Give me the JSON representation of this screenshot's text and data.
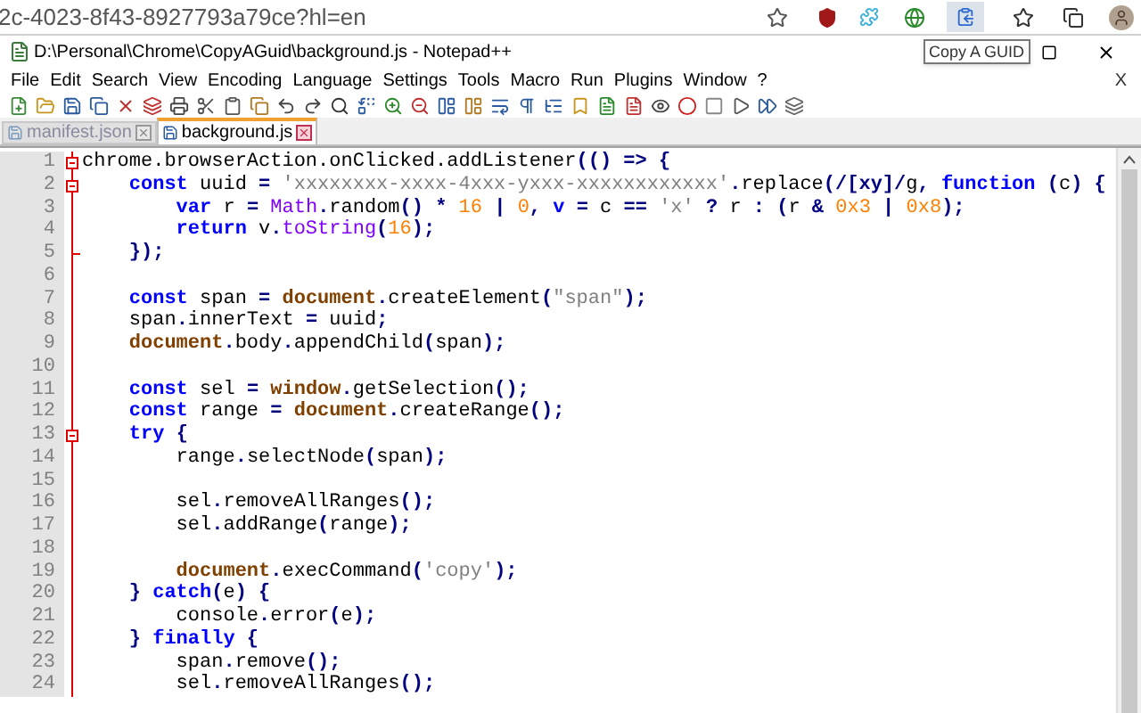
{
  "browser": {
    "url": "2c-4023-8f43-8927793a79ce?hl=en",
    "tooltip": "Copy A GUID"
  },
  "window": {
    "title": "D:\\Personal\\Chrome\\CopyAGuid\\background.js - Notepad++"
  },
  "menu": [
    "File",
    "Edit",
    "Search",
    "View",
    "Encoding",
    "Language",
    "Settings",
    "Tools",
    "Macro",
    "Run",
    "Plugins",
    "Window",
    "?"
  ],
  "menu_close": "X",
  "tabs": [
    {
      "label": "manifest.json",
      "selected": false
    },
    {
      "label": "background.js",
      "selected": true
    }
  ],
  "lines": [
    {
      "number": "1",
      "fold_start": true,
      "fold_end": false,
      "tokens": [
        {
          "kind": "plain",
          "text": "chrome.browserAction.onClicked.addListener"
        },
        {
          "kind": "op",
          "text": "(() => {"
        }
      ]
    },
    {
      "number": "2",
      "fold_start": true,
      "fold_end": false,
      "tokens": [
        {
          "kind": "keyword",
          "text": "    const"
        },
        {
          "kind": "plain",
          "text": " uuid "
        },
        {
          "kind": "op",
          "text": "="
        },
        {
          "kind": "string",
          "text": " 'xxxxxxxx-xxxx-4xxx-yxxx-xxxxxxxxxxxx'"
        },
        {
          "kind": "op",
          "text": "."
        },
        {
          "kind": "plain",
          "text": "replace"
        },
        {
          "kind": "op",
          "text": "(/[xy]/"
        },
        {
          "kind": "plain",
          "text": "g"
        },
        {
          "kind": "op",
          "text": ", "
        },
        {
          "kind": "keyword",
          "text": "function"
        },
        {
          "kind": "op",
          "text": " ("
        },
        {
          "kind": "plain",
          "text": "c"
        },
        {
          "kind": "op",
          "text": ") {"
        }
      ]
    },
    {
      "number": "3",
      "fold_start": false,
      "fold_end": false,
      "tokens": [
        {
          "kind": "keyword",
          "text": "        var"
        },
        {
          "kind": "plain",
          "text": " r "
        },
        {
          "kind": "op",
          "text": "="
        },
        {
          "kind": "builtin",
          "text": " Math"
        },
        {
          "kind": "op",
          "text": "."
        },
        {
          "kind": "plain",
          "text": "random"
        },
        {
          "kind": "op",
          "text": "() * "
        },
        {
          "kind": "number",
          "text": "16"
        },
        {
          "kind": "op",
          "text": " | "
        },
        {
          "kind": "number",
          "text": "0"
        },
        {
          "kind": "op",
          "text": ", "
        },
        {
          "kind": "keyword",
          "text": "v"
        },
        {
          "kind": "op",
          "text": " = "
        },
        {
          "kind": "plain",
          "text": "c"
        },
        {
          "kind": "op",
          "text": " == "
        },
        {
          "kind": "string",
          "text": "'x'"
        },
        {
          "kind": "op",
          "text": " ? "
        },
        {
          "kind": "plain",
          "text": "r"
        },
        {
          "kind": "op",
          "text": " : ("
        },
        {
          "kind": "plain",
          "text": "r"
        },
        {
          "kind": "op",
          "text": " & "
        },
        {
          "kind": "number",
          "text": "0x3"
        },
        {
          "kind": "op",
          "text": " | "
        },
        {
          "kind": "number",
          "text": "0x8"
        },
        {
          "kind": "op",
          "text": ");"
        }
      ]
    },
    {
      "number": "4",
      "fold_start": false,
      "fold_end": false,
      "tokens": [
        {
          "kind": "keyword",
          "text": "        return"
        },
        {
          "kind": "plain",
          "text": " v"
        },
        {
          "kind": "op",
          "text": "."
        },
        {
          "kind": "builtin",
          "text": "toString"
        },
        {
          "kind": "op",
          "text": "("
        },
        {
          "kind": "number",
          "text": "16"
        },
        {
          "kind": "op",
          "text": ");"
        }
      ]
    },
    {
      "number": "5",
      "fold_start": false,
      "fold_end": true,
      "tokens": [
        {
          "kind": "op",
          "text": "    });"
        }
      ]
    },
    {
      "number": "6",
      "fold_start": false,
      "fold_end": false
    },
    {
      "number": "7",
      "fold_start": false,
      "fold_end": false,
      "tokens": [
        {
          "kind": "keyword",
          "text": "    const"
        },
        {
          "kind": "plain",
          "text": " span "
        },
        {
          "kind": "op",
          "text": "="
        },
        {
          "kind": "object",
          "text": " document"
        },
        {
          "kind": "op",
          "text": "."
        },
        {
          "kind": "plain",
          "text": "createElement"
        },
        {
          "kind": "op",
          "text": "("
        },
        {
          "kind": "string",
          "text": "\"span\""
        },
        {
          "kind": "op",
          "text": ");"
        }
      ]
    },
    {
      "number": "8",
      "fold_start": false,
      "fold_end": false,
      "tokens": [
        {
          "kind": "plain",
          "text": "    span"
        },
        {
          "kind": "op",
          "text": "."
        },
        {
          "kind": "plain",
          "text": "innerText "
        },
        {
          "kind": "op",
          "text": "="
        },
        {
          "kind": "plain",
          "text": " uuid"
        },
        {
          "kind": "op",
          "text": ";"
        }
      ]
    },
    {
      "number": "9",
      "fold_start": false,
      "fold_end": false,
      "tokens": [
        {
          "kind": "object",
          "text": "    document"
        },
        {
          "kind": "op",
          "text": "."
        },
        {
          "kind": "plain",
          "text": "body"
        },
        {
          "kind": "op",
          "text": "."
        },
        {
          "kind": "plain",
          "text": "appendChild"
        },
        {
          "kind": "op",
          "text": "("
        },
        {
          "kind": "plain",
          "text": "span"
        },
        {
          "kind": "op",
          "text": ");"
        }
      ]
    },
    {
      "number": "10",
      "fold_start": false,
      "fold_end": false
    },
    {
      "number": "11",
      "fold_start": false,
      "fold_end": false,
      "tokens": [
        {
          "kind": "keyword",
          "text": "    const"
        },
        {
          "kind": "plain",
          "text": " sel "
        },
        {
          "kind": "op",
          "text": "="
        },
        {
          "kind": "object",
          "text": " window"
        },
        {
          "kind": "op",
          "text": "."
        },
        {
          "kind": "plain",
          "text": "getSelection"
        },
        {
          "kind": "op",
          "text": "();"
        }
      ]
    },
    {
      "number": "12",
      "fold_start": false,
      "fold_end": false,
      "tokens": [
        {
          "kind": "keyword",
          "text": "    const"
        },
        {
          "kind": "plain",
          "text": " range "
        },
        {
          "kind": "op",
          "text": "="
        },
        {
          "kind": "object",
          "text": " document"
        },
        {
          "kind": "op",
          "text": "."
        },
        {
          "kind": "plain",
          "text": "createRange"
        },
        {
          "kind": "op",
          "text": "();"
        }
      ]
    },
    {
      "number": "13",
      "fold_start": true,
      "fold_end": false,
      "tokens": [
        {
          "kind": "keyword",
          "text": "    try"
        },
        {
          "kind": "op",
          "text": " {"
        }
      ]
    },
    {
      "number": "14",
      "fold_start": false,
      "fold_end": false,
      "tokens": [
        {
          "kind": "plain",
          "text": "        range"
        },
        {
          "kind": "op",
          "text": "."
        },
        {
          "kind": "plain",
          "text": "selectNode"
        },
        {
          "kind": "op",
          "text": "("
        },
        {
          "kind": "plain",
          "text": "span"
        },
        {
          "kind": "op",
          "text": ");"
        }
      ]
    },
    {
      "number": "15",
      "fold_start": false,
      "fold_end": false
    },
    {
      "number": "16",
      "fold_start": false,
      "fold_end": false,
      "tokens": [
        {
          "kind": "plain",
          "text": "        sel"
        },
        {
          "kind": "op",
          "text": "."
        },
        {
          "kind": "plain",
          "text": "removeAllRanges"
        },
        {
          "kind": "op",
          "text": "();"
        }
      ]
    },
    {
      "number": "17",
      "fold_start": false,
      "fold_end": false,
      "tokens": [
        {
          "kind": "plain",
          "text": "        sel"
        },
        {
          "kind": "op",
          "text": "."
        },
        {
          "kind": "plain",
          "text": "addRange"
        },
        {
          "kind": "op",
          "text": "("
        },
        {
          "kind": "plain",
          "text": "range"
        },
        {
          "kind": "op",
          "text": ");"
        }
      ]
    },
    {
      "number": "18",
      "fold_start": false,
      "fold_end": false
    },
    {
      "number": "19",
      "fold_start": false,
      "fold_end": false,
      "tokens": [
        {
          "kind": "object",
          "text": "        document"
        },
        {
          "kind": "op",
          "text": "."
        },
        {
          "kind": "plain",
          "text": "execCommand"
        },
        {
          "kind": "op",
          "text": "("
        },
        {
          "kind": "string",
          "text": "'copy'"
        },
        {
          "kind": "op",
          "text": ");"
        }
      ]
    },
    {
      "number": "20",
      "fold_start": false,
      "fold_end": false,
      "tokens": [
        {
          "kind": "op",
          "text": "    } "
        },
        {
          "kind": "keyword",
          "text": "catch"
        },
        {
          "kind": "op",
          "text": "("
        },
        {
          "kind": "plain",
          "text": "e"
        },
        {
          "kind": "op",
          "text": ") {"
        }
      ]
    },
    {
      "number": "21",
      "fold_start": false,
      "fold_end": false,
      "tokens": [
        {
          "kind": "plain",
          "text": "        console"
        },
        {
          "kind": "op",
          "text": "."
        },
        {
          "kind": "plain",
          "text": "error"
        },
        {
          "kind": "op",
          "text": "("
        },
        {
          "kind": "plain",
          "text": "e"
        },
        {
          "kind": "op",
          "text": ");"
        }
      ]
    },
    {
      "number": "22",
      "fold_start": false,
      "fold_end": false,
      "tokens": [
        {
          "kind": "op",
          "text": "    } "
        },
        {
          "kind": "keyword",
          "text": "finally"
        },
        {
          "kind": "op",
          "text": " {"
        }
      ]
    },
    {
      "number": "23",
      "fold_start": false,
      "fold_end": false,
      "tokens": [
        {
          "kind": "plain",
          "text": "        span"
        },
        {
          "kind": "op",
          "text": "."
        },
        {
          "kind": "plain",
          "text": "remove"
        },
        {
          "kind": "op",
          "text": "();"
        }
      ]
    },
    {
      "number": "24",
      "fold_start": false,
      "fold_end": false,
      "tokens": [
        {
          "kind": "plain",
          "text": "        sel"
        },
        {
          "kind": "op",
          "text": "."
        },
        {
          "kind": "plain",
          "text": "removeAllRanges"
        },
        {
          "kind": "op",
          "text": "();"
        }
      ]
    }
  ]
}
